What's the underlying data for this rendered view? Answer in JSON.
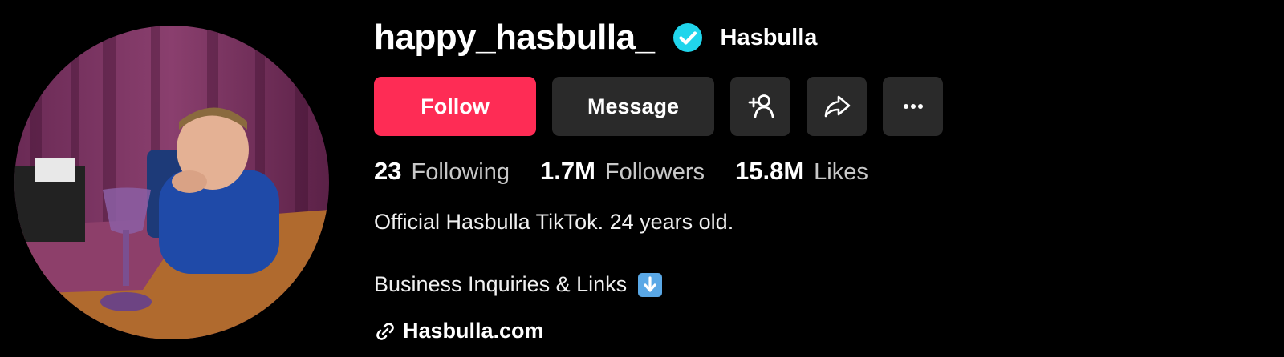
{
  "profile": {
    "username": "happy_hasbulla_",
    "nickname": "Hasbulla",
    "verified": true,
    "avatar_alt": "profile-photo"
  },
  "actions": {
    "follow_label": "Follow",
    "message_label": "Message",
    "add_friend_icon": "add-person-icon",
    "share_icon": "share-icon",
    "more_icon": "more-icon"
  },
  "stats": [
    {
      "value": "23",
      "label": "Following"
    },
    {
      "value": "1.7M",
      "label": "Followers"
    },
    {
      "value": "15.8M",
      "label": "Likes"
    }
  ],
  "bio": {
    "line1": "Official Hasbulla TikTok. 24 years old.",
    "line2": "Business Inquiries & Links",
    "line2_emoji": "down-arrow-emoji",
    "link": "Hasbulla.com"
  },
  "colors": {
    "background": "#000000",
    "follow_button": "#fe2c55",
    "secondary_button": "#2a2a2a",
    "verified_badge": "#20d5ec"
  }
}
